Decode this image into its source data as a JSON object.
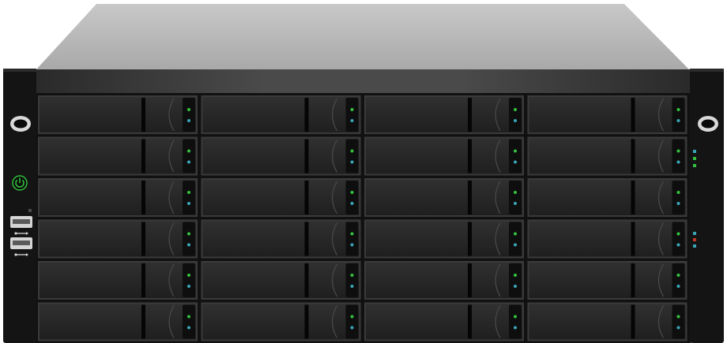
{
  "device": {
    "kind": "rackmount storage server front view",
    "bays": {
      "rows": 6,
      "columns": 4,
      "total": 24
    },
    "colors": {
      "top_cover": "#b9b9b9",
      "bezel": "#141414",
      "tray_face": "#262626",
      "power_led": "#2fbf3a",
      "activity_led_green": "#35c23e",
      "status_led_cyan": "#3aa7b8",
      "indicator_red": "#c0392b"
    },
    "left_ear": {
      "icons": [
        "mounting-hole-icon",
        "power-button-icon",
        "usb-port-icon",
        "usb-port-icon",
        "usb-symbol-icon"
      ]
    },
    "right_ear": {
      "icons": [
        "mounting-hole-icon",
        "status-indicator-icon"
      ]
    }
  }
}
